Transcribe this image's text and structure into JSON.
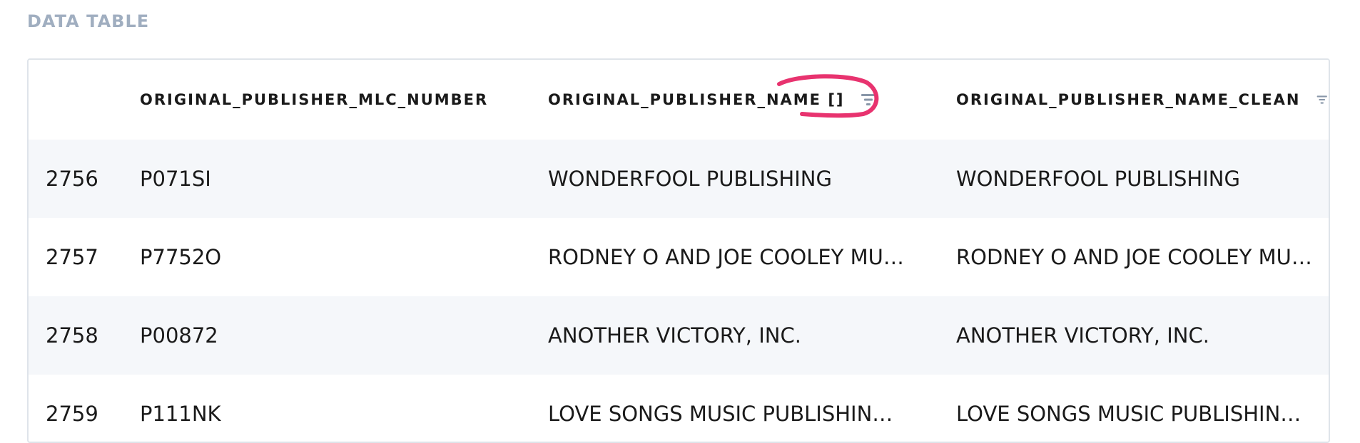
{
  "section_title": "DATA TABLE",
  "table": {
    "columns": [
      "ORIGINAL_PUBLISHER_MLC_NUMBER",
      "ORIGINAL_PUBLISHER_NAME []",
      "ORIGINAL_PUBLISHER_NAME_CLEAN"
    ],
    "rows": [
      {
        "index": "2756",
        "mlc": "P071SI",
        "name": "WONDERFOOL PUBLISHING",
        "clean": "WONDERFOOL PUBLISHING"
      },
      {
        "index": "2757",
        "mlc": "P7752O",
        "name": "RODNEY O AND JOE COOLEY MU…",
        "clean": "RODNEY O AND JOE COOLEY MU…"
      },
      {
        "index": "2758",
        "mlc": "P00872",
        "name": "ANOTHER VICTORY, INC.",
        "clean": "ANOTHER VICTORY, INC."
      },
      {
        "index": "2759",
        "mlc": "P111NK",
        "name": "LOVE SONGS MUSIC PUBLISHIN…",
        "clean": "LOVE SONGS MUSIC PUBLISHIN…"
      }
    ]
  },
  "icons": {
    "filter": "filter-icon"
  },
  "colors": {
    "section_title": "#a0aec0",
    "icon": "#8896a8",
    "annotation": "#e8336f",
    "row_alt": "#f5f7fa",
    "border": "#dfe4ea"
  }
}
